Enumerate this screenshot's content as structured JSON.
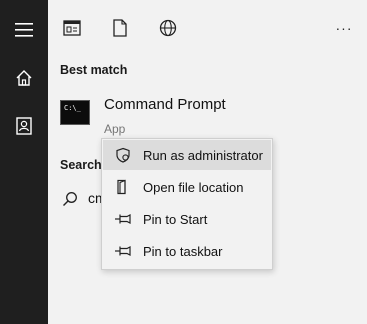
{
  "rail": {
    "items": [
      {
        "icon": "hamburger-menu-icon"
      },
      {
        "icon": "home-icon"
      },
      {
        "icon": "contact-card-icon"
      }
    ]
  },
  "topbar": {
    "icons": [
      "apps-filter-icon",
      "documents-filter-icon",
      "web-filter-icon",
      "more-options-icon"
    ],
    "more_label": "···"
  },
  "best_match": {
    "heading": "Best match",
    "app_name": "Command Prompt",
    "app_type": "App",
    "cmd_glyph": "C:\\_"
  },
  "search": {
    "heading": "Search",
    "query_visible": "cm"
  },
  "context_menu": {
    "items": [
      {
        "label": "Run as administrator",
        "icon": "shield-icon",
        "highlighted": true
      },
      {
        "label": "Open file location",
        "icon": "folder-icon",
        "highlighted": false
      },
      {
        "label": "Pin to Start",
        "icon": "pin-icon",
        "highlighted": false
      },
      {
        "label": "Pin to taskbar",
        "icon": "pin-icon",
        "highlighted": false
      }
    ]
  }
}
